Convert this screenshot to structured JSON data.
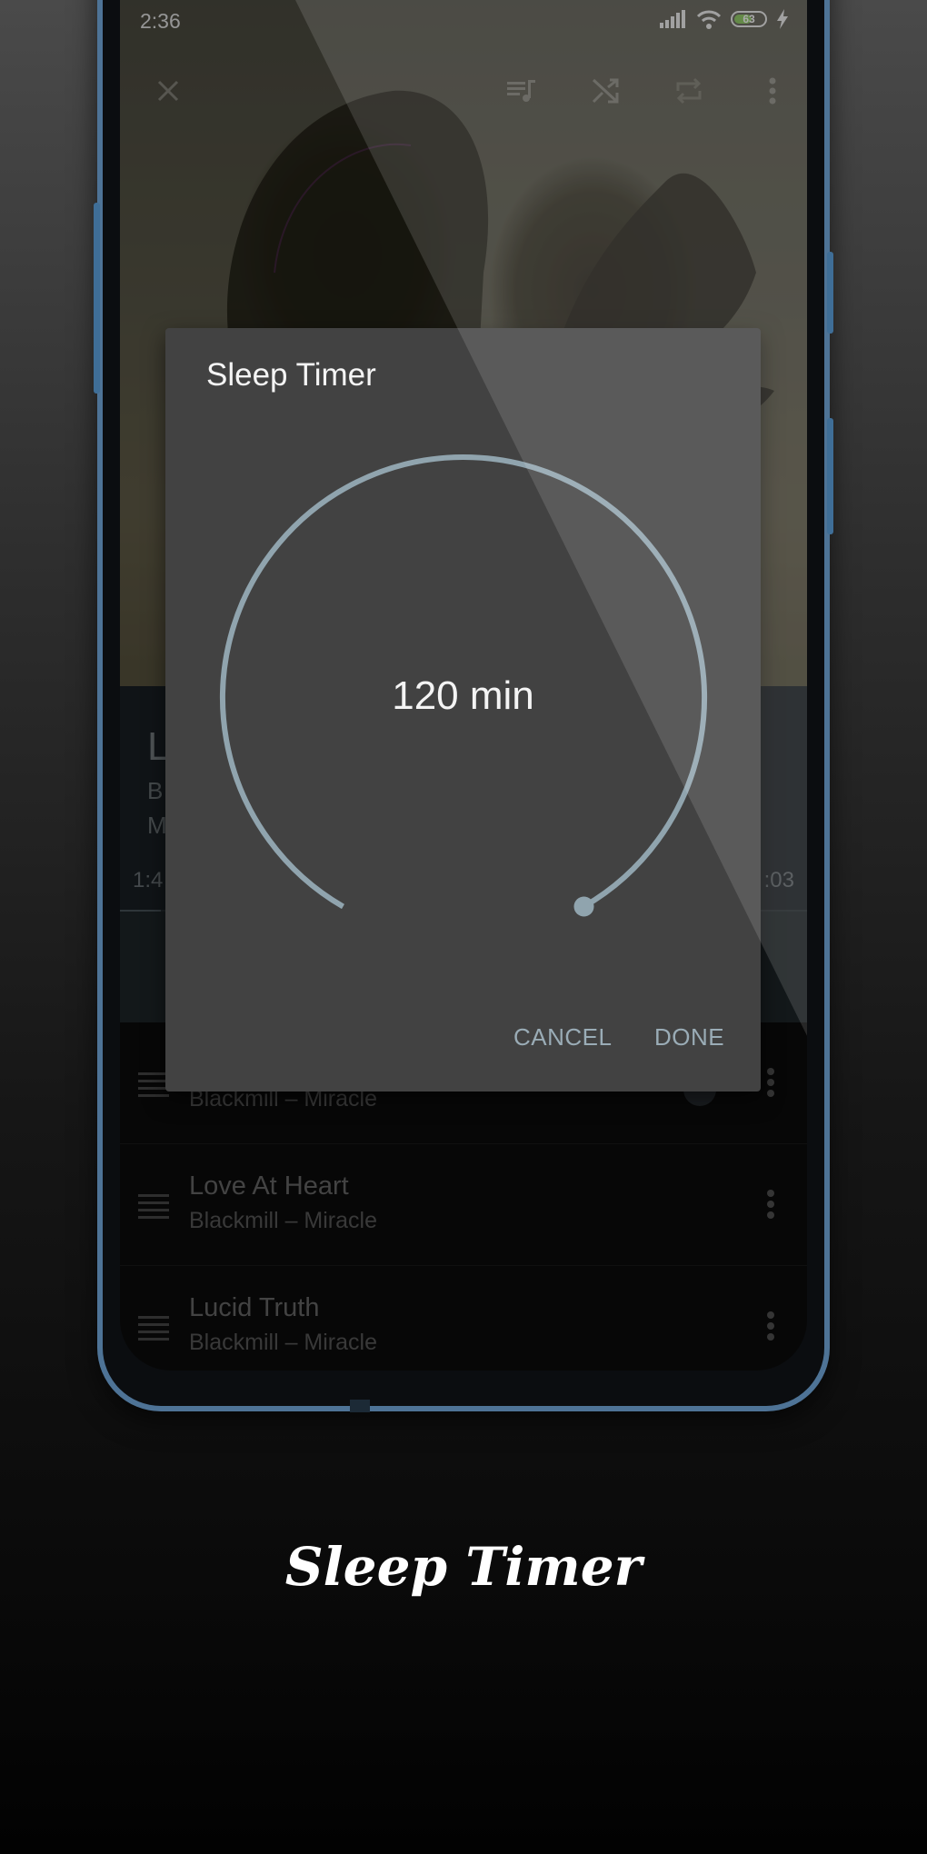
{
  "status_bar": {
    "time": "2:36",
    "battery_percent": 63,
    "battery_label": "63",
    "icons": [
      "signal-icon",
      "wifi-icon",
      "battery-icon",
      "charging-icon"
    ]
  },
  "toolbar": {
    "icons": [
      "close-icon",
      "queue-music-icon",
      "shuffle-icon",
      "repeat-icon",
      "more-vert-icon"
    ]
  },
  "now_playing": {
    "title_partial": "L",
    "artist_partial": "B",
    "album_partial": "M",
    "elapsed_partial": "1:4",
    "total_partial": ":03",
    "progress_fraction": 0.06
  },
  "queue": {
    "items": [
      {
        "title": "",
        "subtitle": "Blackmill – Miracle",
        "playing": true
      },
      {
        "title": "Love At Heart",
        "subtitle": "Blackmill – Miracle",
        "playing": false
      },
      {
        "title": "Lucid Truth",
        "subtitle": "Blackmill – Miracle",
        "playing": false
      }
    ]
  },
  "dialog": {
    "title": "Sleep Timer",
    "value_label": "120 min",
    "value_minutes": 120,
    "max_minutes": 120,
    "cancel_label": "CANCEL",
    "done_label": "DONE",
    "accent_color": "#90a4ae"
  },
  "caption": "Sleep Timer"
}
